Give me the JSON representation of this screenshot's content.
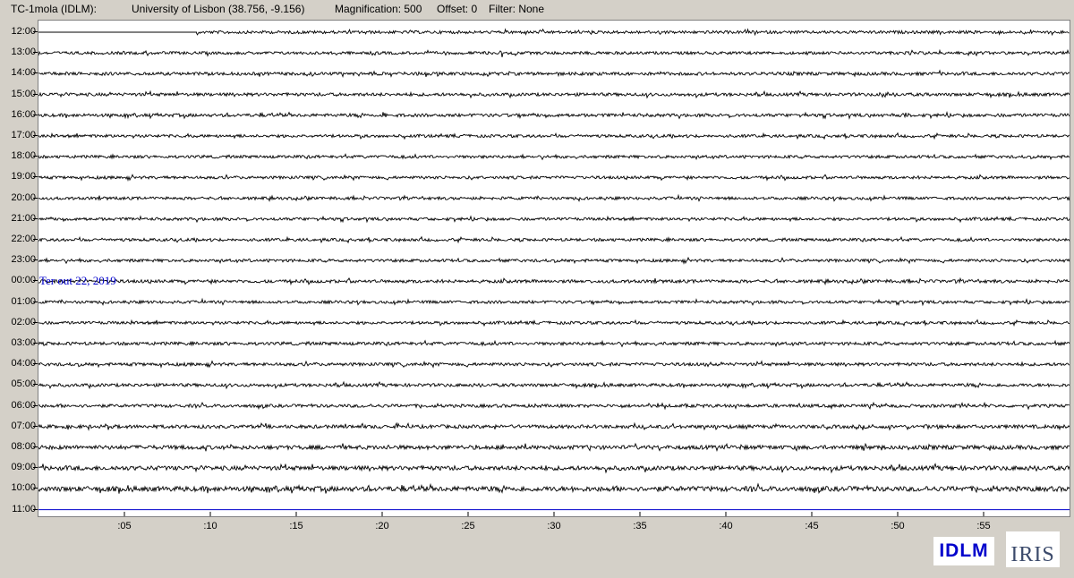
{
  "header": {
    "station": "TC-1mola (IDLM):",
    "location": "University of Lisbon (38.756, -9.156)",
    "magnification": "Magnification: 500",
    "offset": "Offset: 0",
    "filter": "Filter: None"
  },
  "date_note": "Ter out 22, 2019",
  "logos": {
    "idlm": "IDLM",
    "iris": "IRIS"
  },
  "colors": {
    "trace": "#000000",
    "current_line": "#0000cc",
    "date_text": "#0000cc",
    "background": "#d4d0c8"
  },
  "chart_data": {
    "type": "line",
    "title": "",
    "x_tick_labels": [
      ":05",
      ":10",
      ":15",
      ":20",
      ":25",
      ":30",
      ":35",
      ":40",
      ":45",
      ":50",
      ":55"
    ],
    "x_ticks_minutes": [
      5,
      10,
      15,
      20,
      25,
      30,
      35,
      40,
      45,
      50,
      55
    ],
    "xlim": [
      0,
      60
    ],
    "rows": [
      {
        "label": "12:00",
        "amplitude": 0.5,
        "start_minute": 9.2,
        "events": [
          {
            "minute": 9.3,
            "amp": 5
          }
        ]
      },
      {
        "label": "13:00",
        "amplitude": 0.5,
        "events": [
          {
            "minute": 27.0,
            "amp": 6
          }
        ]
      },
      {
        "label": "14:00",
        "amplitude": 0.55,
        "events": []
      },
      {
        "label": "15:00",
        "amplitude": 0.55,
        "events": [
          {
            "minute": 49.2,
            "amp": 6
          }
        ]
      },
      {
        "label": "16:00",
        "amplitude": 0.55,
        "events": [
          {
            "minute": 20.0,
            "amp": 6
          },
          {
            "minute": 50.5,
            "amp": 2
          }
        ]
      },
      {
        "label": "17:00",
        "amplitude": 0.5,
        "events": []
      },
      {
        "label": "18:00",
        "amplitude": 0.5,
        "events": []
      },
      {
        "label": "19:00",
        "amplitude": 0.5,
        "events": []
      },
      {
        "label": "20:00",
        "amplitude": 0.5,
        "events": []
      },
      {
        "label": "21:00",
        "amplitude": 0.5,
        "events": []
      },
      {
        "label": "22:00",
        "amplitude": 0.5,
        "events": []
      },
      {
        "label": "23:00",
        "amplitude": 0.5,
        "events": []
      },
      {
        "label": "00:00",
        "amplitude": 0.55,
        "events": []
      },
      {
        "label": "01:00",
        "amplitude": 0.5,
        "events": []
      },
      {
        "label": "02:00",
        "amplitude": 0.5,
        "events": []
      },
      {
        "label": "03:00",
        "amplitude": 0.55,
        "events": []
      },
      {
        "label": "04:00",
        "amplitude": 0.55,
        "events": [
          {
            "minute": 39.0,
            "amp": 2
          }
        ]
      },
      {
        "label": "05:00",
        "amplitude": 0.55,
        "events": []
      },
      {
        "label": "06:00",
        "amplitude": 0.55,
        "events": []
      },
      {
        "label": "07:00",
        "amplitude": 0.6,
        "events": []
      },
      {
        "label": "08:00",
        "amplitude": 0.7,
        "events": []
      },
      {
        "label": "09:00",
        "amplitude": 0.75,
        "events": []
      },
      {
        "label": "10:00",
        "amplitude": 0.85,
        "end_minute": 60,
        "events": []
      },
      {
        "label": "11:00",
        "amplitude": 0,
        "current": true,
        "events": []
      }
    ]
  }
}
